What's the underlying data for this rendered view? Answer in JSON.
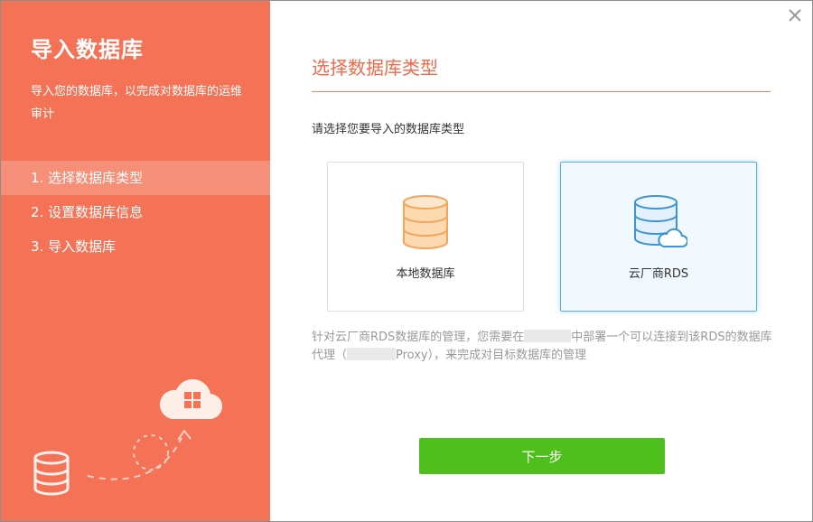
{
  "sidebar": {
    "title": "导入数据库",
    "subtitle": "导入您的数据库，以完成对数据库的运维审计",
    "steps": [
      {
        "label": "1. 选择数据库类型"
      },
      {
        "label": "2. 设置数据库信息"
      },
      {
        "label": "3. 导入数据库"
      }
    ],
    "active_step": 1
  },
  "main": {
    "heading": "选择数据库类型",
    "prompt": "请选择您要导入的数据库类型",
    "options": [
      {
        "label": "本地数据库",
        "icon": "local-database-icon",
        "selected": false
      },
      {
        "label": "云厂商RDS",
        "icon": "cloud-database-icon",
        "selected": true
      }
    ],
    "note": {
      "part1": "针对云厂商RDS数据库的管理，您需要在",
      "part2": "中部署一个可以连接到该RDS的数据库代理（",
      "part3": "Proxy），来完成对目标数据库的管理"
    },
    "next_label": "下一步"
  },
  "colors": {
    "sidebar_bg": "#f47356",
    "accent": "#ef6a4b",
    "primary_button": "#4fbf1e",
    "selected_border": "#58b1ea"
  }
}
